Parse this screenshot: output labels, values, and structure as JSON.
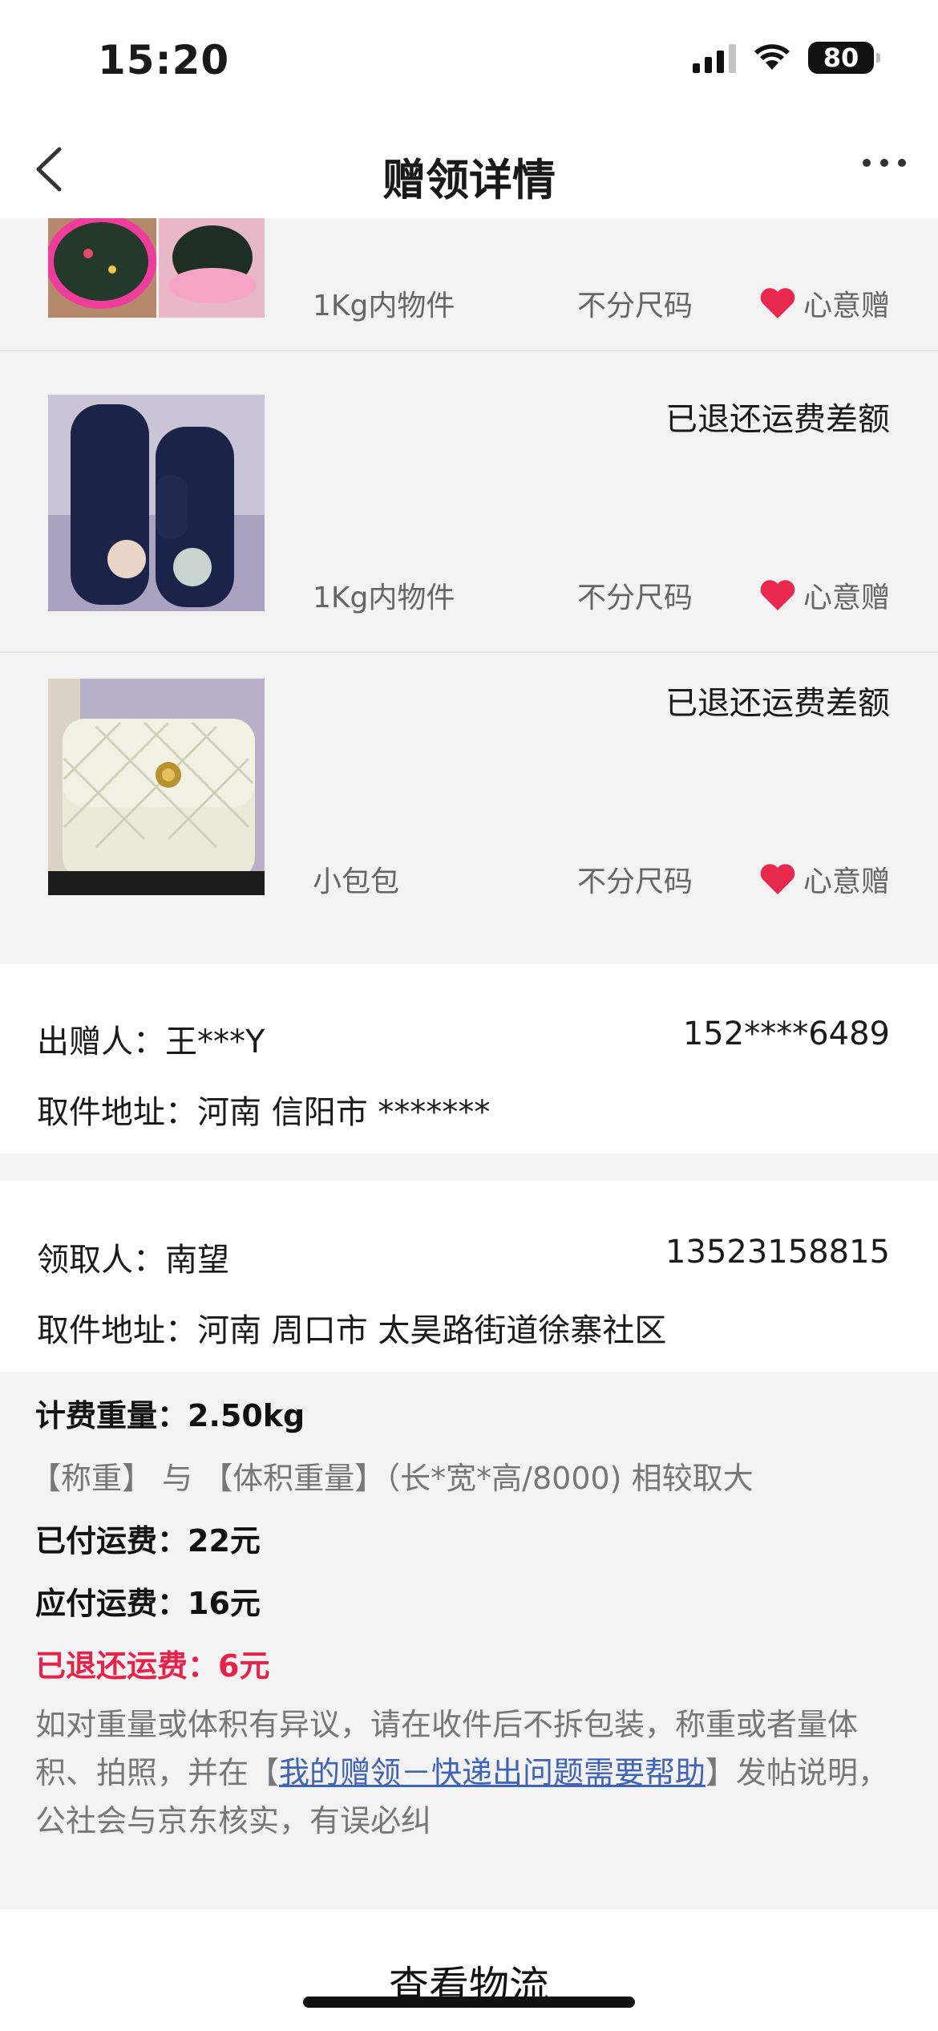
{
  "status_bar": {
    "time": "15:20",
    "battery": "80"
  },
  "nav": {
    "title": "赠领详情"
  },
  "items": [
    {
      "status": "",
      "weight": "1Kg内物件",
      "size": "不分尺码",
      "gift": "心意赠"
    },
    {
      "status": "已退还运费差额",
      "weight": "1Kg内物件",
      "size": "不分尺码",
      "gift": "心意赠"
    },
    {
      "status": "已退还运费差额",
      "weight": "小包包",
      "size": "不分尺码",
      "gift": "心意赠"
    }
  ],
  "giver": {
    "label": "出赠人：",
    "name": "王***Y",
    "phone": "152****6489",
    "address_label": "取件地址：",
    "address": "河南 信阳市 *******"
  },
  "receiver": {
    "label": "领取人：",
    "name": "南望",
    "phone": "13523158815",
    "address_label": "取件地址：",
    "address": "河南 周口市 太昊路街道徐寨社区"
  },
  "fees": {
    "billing_weight": "计费重量：2.50kg",
    "rule": "【称重】 与 【体积重量】（长*宽*高/8000) 相较取大",
    "paid": "已付运费：22元",
    "due": "应付运费：16元",
    "refunded": "已退还运费：6元",
    "notice_before": "如对重量或体积有异议，请在收件后不拆包装，称重或者量体积、拍照，并在【",
    "notice_link": "我的赠领－快递出问题需要帮助",
    "notice_after": "】发帖说明，公社会与京东核实，有误必纠"
  },
  "bottom": {
    "logistics_label": "查看物流"
  },
  "colors": {
    "accent_red": "#e6224a",
    "link_blue": "#3f63b8",
    "heart": "#e8294d"
  }
}
